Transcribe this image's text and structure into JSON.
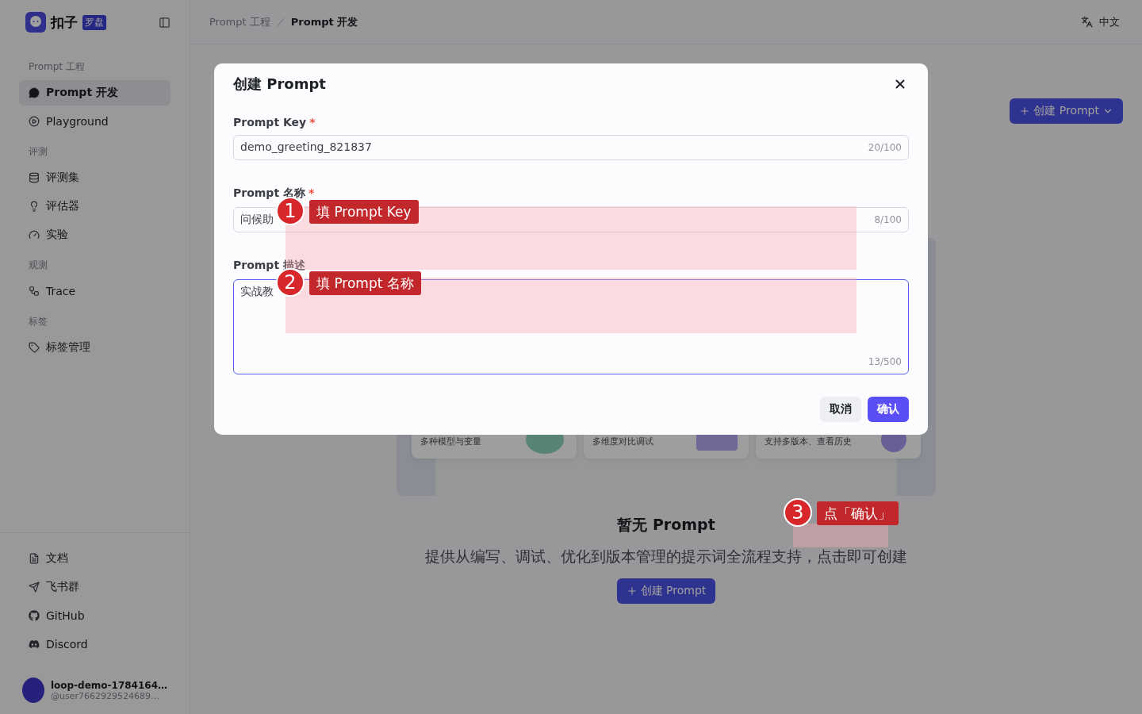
{
  "sidebar": {
    "brand": "扣子",
    "brand_tag": "罗盘",
    "groups": [
      {
        "title": "Prompt 工程",
        "items": [
          {
            "label": "Prompt 开发",
            "selected": true
          },
          {
            "label": "Playground",
            "selected": false
          }
        ]
      },
      {
        "title": "评测",
        "items": [
          {
            "label": "评测集",
            "selected": false
          },
          {
            "label": "评估器",
            "selected": false
          },
          {
            "label": "实验",
            "selected": false
          }
        ]
      },
      {
        "title": "观测",
        "items": [
          {
            "label": "Trace",
            "selected": false
          }
        ]
      },
      {
        "title": "标签",
        "items": [
          {
            "label": "标签管理",
            "selected": false
          }
        ]
      }
    ],
    "links": [
      "文档",
      "飞书群",
      "GitHub",
      "Discord"
    ],
    "user": {
      "name": "loop-demo-1784164…",
      "handle": "@user7662929524689…"
    }
  },
  "breadcrumb": [
    {
      "label": "Prompt 工程",
      "selected": false
    },
    {
      "label": "Prompt 开发",
      "selected": true
    }
  ],
  "language": "中文",
  "toolbar": {
    "create_button": "创建 Prompt"
  },
  "features": [
    "多种模型与变量",
    "多维度对比调试",
    "支持多版本、查看历史"
  ],
  "empty_state": {
    "title": "暂无 Prompt",
    "description": "提供从编写、调试、优化到版本管理的提示词全流程支持，点击即可创建",
    "button": "创建 Prompt"
  },
  "dialog": {
    "title": "创建 Prompt",
    "fields": [
      {
        "kind": "input",
        "label": "Prompt Key",
        "required_mark": "*",
        "value": "demo_greeting_821837",
        "count": "20/100",
        "focused": false
      },
      {
        "kind": "input",
        "label": "Prompt 名称",
        "required_mark": "*",
        "value": "问候助",
        "count": "8/100",
        "focused": false
      },
      {
        "kind": "textarea",
        "label": "Prompt 描述",
        "value": "实战教",
        "count": "13/500",
        "focused": true
      }
    ],
    "buttons": [
      {
        "label": "取消",
        "kind": "secondary"
      },
      {
        "label": "确认",
        "kind": "primary"
      }
    ]
  },
  "annotations": [
    {
      "number": "1",
      "label": "填 Prompt Key"
    },
    {
      "number": "2",
      "label": "填 Prompt 名称"
    },
    {
      "number": "3",
      "label": "点「确认」"
    }
  ]
}
